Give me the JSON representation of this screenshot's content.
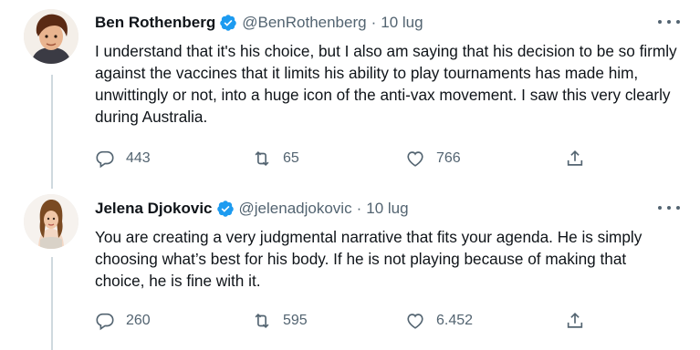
{
  "tweets": [
    {
      "author": {
        "name": "Ben Rothenberg",
        "handle": "@BenRothenberg",
        "verified": true
      },
      "date": "10 lug",
      "separator": "·",
      "text": "I understand that it's his choice, but I also am saying that his decision to be so firmly against the vaccines that it limits his ability to play tournaments has made him, unwittingly or not, into a huge icon of the anti-vax movement. I saw this very clearly during Australia.",
      "stats": {
        "replies": "443",
        "retweets": "65",
        "likes": "766"
      }
    },
    {
      "author": {
        "name": "Jelena Djokovic",
        "handle": "@jelenadjokovic",
        "verified": true
      },
      "date": "10 lug",
      "separator": "·",
      "text": "You are creating a very judgmental narrative that fits your agenda. He is simply choosing what’s best for his body. If he is not playing because of making that choice, he is fine with it.",
      "stats": {
        "replies": "260",
        "retweets": "595",
        "likes": "6.452"
      }
    }
  ],
  "icons": {
    "reply": "reply-icon",
    "retweet": "retweet-icon",
    "like": "heart-icon",
    "share": "share-icon",
    "more": "more-icon",
    "verified": "verified-badge-icon"
  },
  "colors": {
    "accent": "#1d9bf0",
    "muted": "#536471",
    "text": "#0f1419",
    "line": "#cfd9de"
  }
}
